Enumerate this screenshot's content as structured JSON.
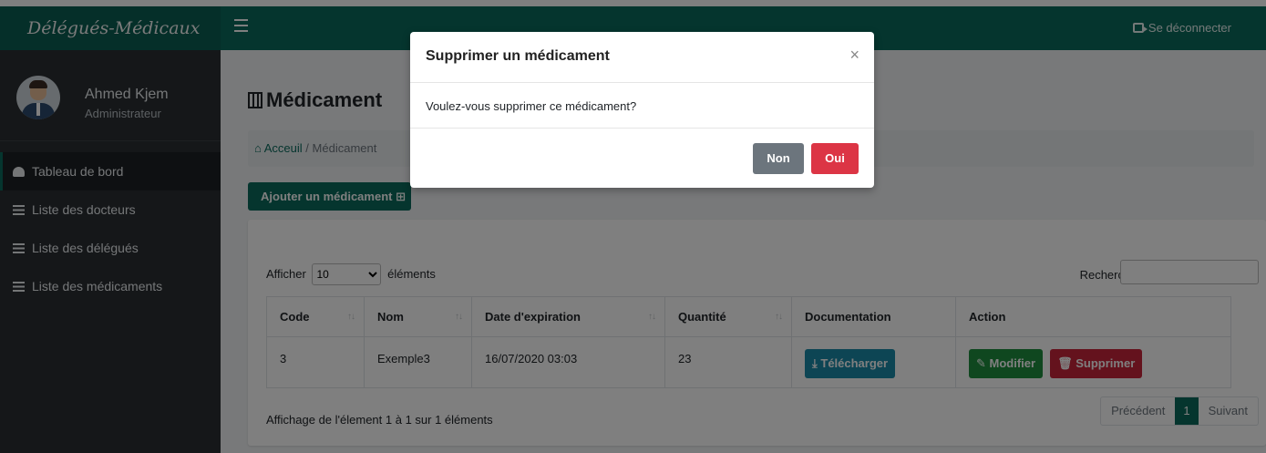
{
  "brand": "Délégués-Médicaux",
  "header": {
    "logout_label": "Se déconnecter"
  },
  "user": {
    "name": "Ahmed Kjem",
    "role": "Administrateur"
  },
  "sidebar": {
    "items": [
      {
        "label": "Tableau de bord",
        "icon": "tachometer-icon",
        "active": true
      },
      {
        "label": "Liste des docteurs",
        "icon": "list-icon"
      },
      {
        "label": "Liste des délégués",
        "icon": "list-icon"
      },
      {
        "label": "Liste des médicaments",
        "icon": "list-icon"
      }
    ]
  },
  "page": {
    "title": "Médicament",
    "breadcrumb_home": "Acceuil",
    "breadcrumb_current": "Médicament",
    "add_button": "Ajouter un médicament"
  },
  "table": {
    "show_prefix": "Afficher",
    "show_value": "10",
    "show_suffix": "éléments",
    "search_label": "Rechercher :",
    "columns": [
      "Code",
      "Nom",
      "Date d'expiration",
      "Quantité",
      "Documentation",
      "Action"
    ],
    "rows": [
      {
        "code": "3",
        "nom": "Exemple3",
        "date": "16/07/2020 03:03",
        "quantite": "23"
      }
    ],
    "download_label": "Télécharger",
    "edit_label": "Modifier",
    "delete_label": "Supprimer",
    "info": "Affichage de l'élement 1 à 1 sur 1 éléments",
    "prev": "Précédent",
    "page": "1",
    "next": "Suivant"
  },
  "modal": {
    "title": "Supprimer un médicament",
    "close": "×",
    "body": "Voulez-vous supprimer ce médicament?",
    "no": "Non",
    "yes": "Oui"
  },
  "colors": {
    "primary": "#0b6b5d",
    "danger": "#dc3545",
    "info": "#1a8aa8",
    "success": "#1e8e3e",
    "sidebar": "#2a2f33"
  }
}
